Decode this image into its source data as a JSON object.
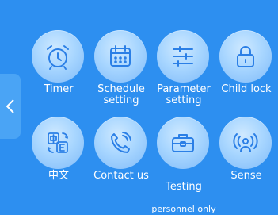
{
  "nav": {
    "back_icon": "chevron-left-icon"
  },
  "tiles": [
    {
      "label": "Timer",
      "icon": "alarm-clock-icon"
    },
    {
      "label": "Schedule\nsetting",
      "icon": "calendar-icon"
    },
    {
      "label": "Parameter\nsetting",
      "icon": "sliders-icon"
    },
    {
      "label": "Child lock",
      "icon": "lock-icon"
    },
    {
      "label": "中文",
      "icon": "language-icon"
    },
    {
      "label": "Contact us",
      "icon": "phone-icon"
    },
    {
      "label_line1": "Testing",
      "label_line2": "personnel only",
      "icon": "toolbox-icon"
    },
    {
      "label": "Sense",
      "icon": "sensor-person-icon"
    }
  ],
  "colors": {
    "background": "#2d8ff0",
    "icon_stroke": "#2b7fe6",
    "text": "#ffffff"
  }
}
